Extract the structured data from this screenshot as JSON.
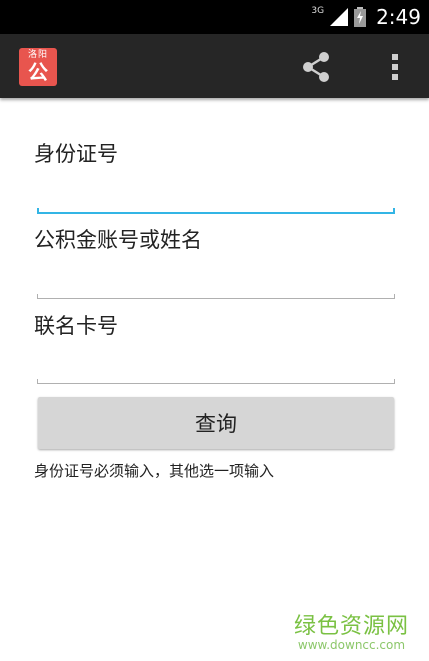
{
  "status_bar": {
    "network": "3G",
    "time": "2:49"
  },
  "action_bar": {
    "app_icon_top": "洛阳",
    "app_icon_main": "公",
    "icons": [
      "share-icon",
      "overflow-menu-icon"
    ]
  },
  "form": {
    "id_label": "身份证号",
    "id_value": "",
    "account_label": "公积金账号或姓名",
    "account_value": "",
    "card_label": "联名卡号",
    "card_value": "",
    "query_button": "查询",
    "hint": "身份证号必须输入，其他选一项输入"
  },
  "watermark": {
    "title": "绿色资源网",
    "url": "www.downcc.com"
  },
  "colors": {
    "action_bar": "#262626",
    "app_icon": "#e8554e",
    "focus_underline": "#33b5e5",
    "watermark": "#7ac143"
  }
}
